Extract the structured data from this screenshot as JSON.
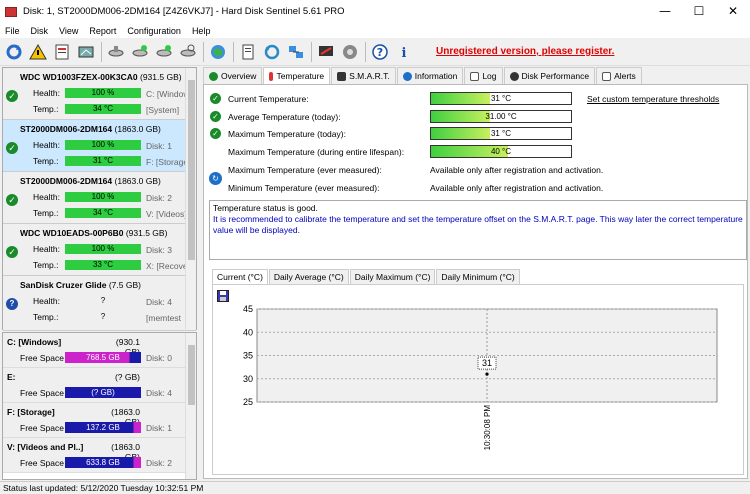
{
  "window": {
    "title": "Disk: 1, ST2000DM006-2DM164 [Z4Z6VKJ7]  -  Hard Disk Sentinel 5.61 PRO",
    "min": "—",
    "max": "☐",
    "close": "✕"
  },
  "menu": [
    "File",
    "Disk",
    "View",
    "Report",
    "Configuration",
    "Help"
  ],
  "unregistered": "Unregistered version, please register.",
  "disks": [
    {
      "name": "WDC WD1003FZEX-00K3CA0",
      "size": "(931.5 GB)",
      "health": "100 %",
      "health_pct": 100,
      "temp": "34 °C",
      "side1": "C: [Windows]",
      "side2": "[System]",
      "status": "ok"
    },
    {
      "name": "ST2000DM006-2DM164",
      "size": "(1863.0 GB)",
      "health": "100 %",
      "health_pct": 100,
      "temp": "31 °C",
      "side1": "Disk: 1",
      "side2": "F: [Storage]",
      "status": "ok"
    },
    {
      "name": "ST2000DM006-2DM164",
      "size": "(1863.0 GB)",
      "health": "100 %",
      "health_pct": 100,
      "temp": "34 °C",
      "side1": "Disk: 2",
      "side2": "V: [Videos]",
      "status": "ok"
    },
    {
      "name": "WDC WD10EADS-00P6B0",
      "size": "(931.5 GB)",
      "health": "100 %",
      "health_pct": 100,
      "temp": "33 °C",
      "side1": "Disk: 3",
      "side2": "X: [Recove",
      "status": "ok"
    },
    {
      "name": "SanDisk Cruzer Glide",
      "size": "(7.5 GB)",
      "health": "?",
      "temp": "?",
      "side1": "Disk: 4",
      "side2": "[memtest",
      "status": "unknown"
    }
  ],
  "labels": {
    "health": "Health:",
    "temp": "Temp.:",
    "free": "Free Space"
  },
  "volumes": [
    {
      "name": "C: [Windows]",
      "size": "(930.1 GB)",
      "free": "768.5 GB",
      "disk": "Disk: 0",
      "style": "magenta"
    },
    {
      "name": "E:",
      "size": "(? GB)",
      "free": "(? GB)",
      "disk": "Disk: 4",
      "style": "blue"
    },
    {
      "name": "F: [Storage]",
      "size": "(1863.0 GB)",
      "free": "137.2 GB",
      "disk": "Disk: 1",
      "style": "nav"
    },
    {
      "name": "V: [Videos and Pl..]",
      "size": "(1863.0 GB)",
      "free": "633.8 GB",
      "disk": "Disk: 2",
      "style": "nav"
    }
  ],
  "tabs": [
    "Overview",
    "Temperature",
    "S.M.A.R.T.",
    "Information",
    "Log",
    "Disk Performance",
    "Alerts"
  ],
  "temperature": {
    "current_label": "Current Temperature:",
    "current": "31 °C",
    "current_fill": 0.42,
    "avg_label": "Average Temperature (today):",
    "avg": "31.00 °C",
    "avg_fill": 0.42,
    "max_label": "Maximum Temperature (today):",
    "max": "31 °C",
    "max_fill": 0.42,
    "life_label": "Maximum Temperature (during entire lifespan):",
    "life": "40 °C",
    "life_fill": 0.55,
    "ever_max_label": "Maximum Temperature (ever measured):",
    "ever_max": "Available only after registration and activation.",
    "ever_min_label": "Minimum Temperature (ever measured):",
    "ever_min": "Available only after registration and activation.",
    "threshold_link": "Set custom temperature thresholds",
    "status_line1": "Temperature status is good.",
    "status_line2": "It is recommended to calibrate the temperature and set the temperature offset on the S.M.A.R.T. page. This way later the correct temperature value will be displayed."
  },
  "chart_tabs": [
    "Current (°C)",
    "Daily Average (°C)",
    "Daily Maximum (°C)",
    "Daily Minimum (°C)"
  ],
  "chart_data": {
    "type": "line",
    "y_ticks": [
      "45",
      "40",
      "35",
      "30",
      "25"
    ],
    "ylim": [
      25,
      45
    ],
    "points": [
      {
        "x": "10:30:08 PM",
        "y": 31
      }
    ],
    "point_label": "31",
    "x_label": "10:30:08 PM"
  },
  "status_bar": "Status last updated: 5/12/2020 Tuesday 10:32:51 PM"
}
